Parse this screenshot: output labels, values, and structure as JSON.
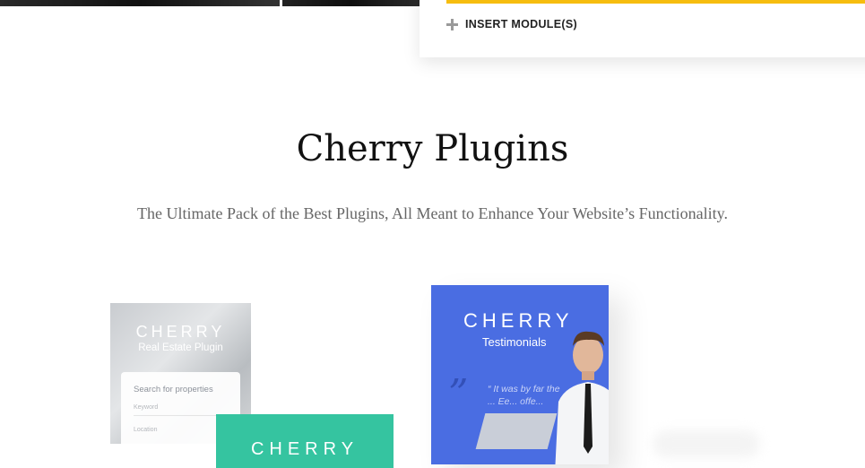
{
  "insert_modules": {
    "label": "INSERT MODULE(S)",
    "accent_color": "#f6bd0f"
  },
  "section": {
    "title": "Cherry Plugins",
    "subtitle": "The Ultimate Pack of the Best Plugins, All Meant to Enhance Your Website’s Functionality."
  },
  "cards": {
    "real_estate": {
      "brand": "CHERRY",
      "subtitle": "Real Estate Plugin",
      "form_title": "Search for properties",
      "field1": "Keyword",
      "field2": "Location"
    },
    "green": {
      "brand": "CHERRY",
      "color": "#35c4a0"
    },
    "testimonials": {
      "brand": "CHERRY",
      "subtitle": "Testimonials",
      "quote": "“ It was by far the ... Ee... offe...",
      "color": "#4a6de2"
    }
  }
}
